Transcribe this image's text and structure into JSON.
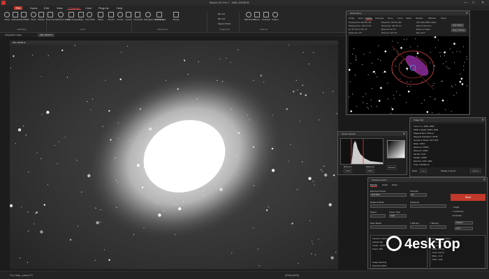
{
  "window": {
    "title": "Maxim DL Pro 7 - M81-00038.fit",
    "minimize": "—",
    "maximize": "□",
    "close": "✕"
  },
  "menu": {
    "tabs": [
      "File",
      "Home",
      "Edit",
      "View",
      "Process",
      "Color",
      "Plug-Ins",
      "Help"
    ],
    "active": "Process"
  },
  "ribbon": {
    "buttons": [
      {
        "label": "Setup",
        "icon": "gear-icon"
      },
      {
        "label": "Calibrate",
        "icon": "calibrate-icon"
      },
      {
        "label": "Kill DMRE",
        "icon": "kill-icon"
      },
      {
        "label": "Stack",
        "icon": "stack-icon"
      },
      {
        "label": "Stacker",
        "icon": "stacker-icon"
      },
      {
        "label": "Photometry",
        "icon": "photometry-icon"
      },
      {
        "label": "PinPoint Solve",
        "icon": "pinpoint-icon"
      },
      {
        "label": "PFF Analysis",
        "icon": "pff-icon"
      },
      {
        "label": "Align",
        "icon": "align-icon"
      },
      {
        "label": "Pixel Math",
        "icon": "pixel-math-icon"
      },
      {
        "label": "Filters",
        "icon": "filter-icon"
      },
      {
        "label": "Stretch",
        "icon": "stretch-icon"
      },
      {
        "label": "Curves",
        "icon": "curves-icon"
      },
      {
        "label": "Levels",
        "icon": "levels-icon"
      },
      {
        "label": "Threshold",
        "icon": "threshold-icon"
      },
      {
        "label": "Histogram Specification",
        "icon": "histogram-icon"
      },
      {
        "label": "Add Noise",
        "icon": "noise-icon"
      },
      {
        "label": "Resize",
        "icon": "resize-icon"
      },
      {
        "label": "Bad Pixels",
        "icon": "bad-pixels-icon"
      },
      {
        "label": "Bloom",
        "icon": "bloom-icon"
      },
      {
        "label": "Pedestal",
        "icon": "pedestal-icon"
      },
      {
        "label": "Flatten",
        "icon": "flatten-icon"
      }
    ],
    "checks": [
      "Bin 2x2",
      "Bin 3x3",
      "Square Pixels"
    ],
    "groups": [
      "Calibration",
      "Tools",
      "Adjustment",
      "Image Size",
      "Cleanup"
    ]
  },
  "doctabs": [
    "Autoguider Image",
    "M81-00038.fit"
  ],
  "viewport": {
    "title": "M81-00038.fit"
  },
  "status": {
    "left": "For Help, press F1",
    "right": "4096x4096"
  },
  "observatory": {
    "title": "Observatory",
    "tabs": [
      "All Sky",
      "Dome",
      "Catalog",
      "Telescope",
      "Dome",
      "Focus",
      "Status",
      "Weather",
      "Webcam",
      "Setup"
    ],
    "active_tab": "Catalog",
    "lines": [
      "Telescope RA: 09h 55m 33s",
      "Telescope Dec: +69° 04' 00\"",
      "Alt: 42° 18'  Az: 011° 21'",
      "Rotator PA: 147°"
    ],
    "lines2": [
      "Mouse RA: 10h 02m 18s",
      "Mouse Dec: +68° 55' 10\"",
      "Mouse Alt: 42° 07'",
      "Mouse Az: 012° 02'"
    ],
    "lines3": [
      "NGC 3031 (M81) Galaxy",
      "Mag 6.9  Size 26.9'",
      "Mouse: no object",
      "Map: 90.0°"
    ],
    "buttons": [
      "Goto Object",
      "Slew to Mouse"
    ]
  },
  "stretch": {
    "title": "Screen Stretch",
    "min_label": "Minimum",
    "max_label": "Maximum",
    "min_value": "12255",
    "max_value": "18600",
    "mode": "Manual"
  },
  "info": {
    "title": "Image Info",
    "mode_label": "Mode",
    "mode_value": "Area",
    "display_label": "Display in Arcsec",
    "calibrate_label": "Calibrate",
    "rows": [
      "Area: (1, 2, 4096, 4096)",
      "Width x Height: 4096 x 4096",
      "Diagonal Size: 5793 px",
      "Diagonal Orientation: 45.00°",
      "Number of Pixels: 16777216",
      "Mean: 13421",
      "Maximum: 65535",
      "Minimum: 10357",
      "Std Dev: 2217",
      "Median: 12958",
      "Max Pos: 1766, 1893",
      "Total: 2.2516E+11"
    ]
  },
  "camera": {
    "title": "Camera Control",
    "tabs": [
      "Expose",
      "Guide",
      "Setup"
    ],
    "exposure_preset_label": "Exposure Preset",
    "exposure_preset": "Test Shot",
    "seconds_label": "Seconds",
    "seconds": "30",
    "readout_label": "Readout Mode",
    "subframe_label": "Subframe",
    "speed_label": "Speed",
    "frame_type_label": "Frame Type",
    "frame_type": "Light",
    "filter_wheel_label": "Filter Wheel",
    "x_binning_label": "X Binning",
    "y_binning_label": "Y Binning",
    "start": "Start",
    "single": "Single",
    "continuous": "Continuous",
    "autosave": "Autosave",
    "options": "Options",
    "less": "Less",
    "cam1_title": "Camera 1 Information",
    "cam1_lines": [
      "Camera Idle",
      "Cooler: -15.0°C",
      "Power: 46%"
    ],
    "cam2_title": "Camera 2 Information",
    "cam2_lines": [
      "Guiding CCD Camera",
      "Camera Idle",
      "Xmas: 0.18 px",
      "Ymas: 0.22 px",
      "XRms: -0.11",
      "YRms: -0.09"
    ],
    "download_label": "Image Acquiring",
    "download_status": "Download 100%"
  },
  "watermark": {
    "text": "4eskTop"
  }
}
